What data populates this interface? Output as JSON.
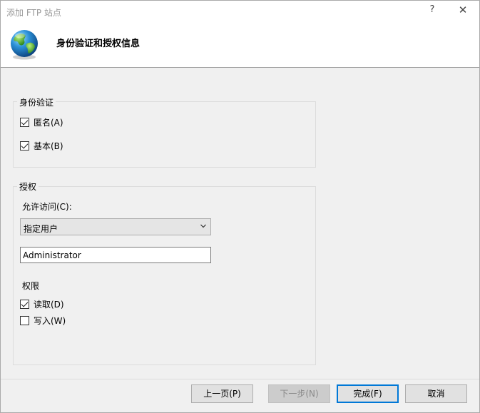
{
  "window": {
    "title": "添加 FTP 站点",
    "help_glyph": "?",
    "close_glyph": "✕"
  },
  "header": {
    "title": "身份验证和授权信息",
    "icon": "globe-icon"
  },
  "authentication": {
    "legend": "身份验证",
    "anonymous": {
      "label": "匿名(A)",
      "checked": true
    },
    "basic": {
      "label": "基本(B)",
      "checked": true
    }
  },
  "authorization": {
    "legend": "授权",
    "allow_access_label": "允许访问(C):",
    "allow_access_selected": "指定用户",
    "users_value": "Administrator",
    "permissions_label": "权限",
    "read": {
      "label": "读取(D)",
      "checked": true
    },
    "write": {
      "label": "写入(W)",
      "checked": false
    }
  },
  "buttons": {
    "previous": "上一页(P)",
    "next": "下一步(N)",
    "finish": "完成(F)",
    "cancel": "取消"
  }
}
